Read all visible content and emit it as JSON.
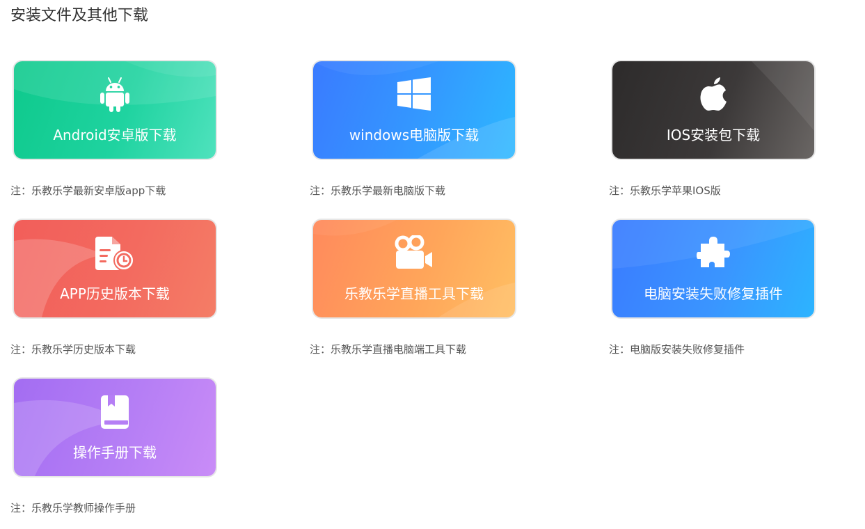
{
  "page": {
    "title": "安装文件及其他下载"
  },
  "items": [
    {
      "icon": "android-icon",
      "label": "Android安卓版下载",
      "note": "注：乐教乐学最新安卓版app下载",
      "color": "#0ec98c"
    },
    {
      "icon": "windows-icon",
      "label": "windows电脑版下载",
      "note": "注：乐教乐学最新电脑版下载",
      "color": "#3a7bff"
    },
    {
      "icon": "apple-icon",
      "label": "IOS安装包下载",
      "note": "注：乐教乐学苹果IOS版",
      "color": "#2d2b2b"
    },
    {
      "icon": "history-document-clock-icon",
      "label": "APP历史版本下载",
      "note": "注：乐教乐学历史版本下载",
      "color": "#f25e5a"
    },
    {
      "icon": "video-camera-icon",
      "label": "乐教乐学直播工具下载",
      "note": "注：乐教乐学直播电脑端工具下载",
      "color": "#ff8a5c"
    },
    {
      "icon": "puzzle-piece-icon",
      "label": "电脑安装失败修复插件",
      "note": "注：电脑版安装失败修复插件",
      "color": "#3a7bff"
    },
    {
      "icon": "book-icon",
      "label": "操作手册下载",
      "note": "注：乐教乐学教师操作手册",
      "color": "#a36df2"
    }
  ]
}
